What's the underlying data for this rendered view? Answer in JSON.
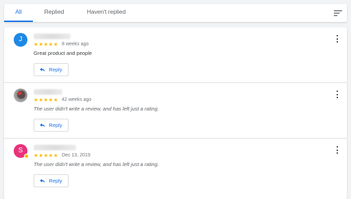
{
  "tabs": [
    {
      "label": "All",
      "active": true
    },
    {
      "label": "Replied",
      "active": false
    },
    {
      "label": "Haven't replied",
      "active": false
    }
  ],
  "colors": {
    "accent": "#1a73e8",
    "star": "#fbbc04"
  },
  "reviews": [
    {
      "avatar_letter": "J",
      "avatar_color": "#1e88e5",
      "stars": "★★★★★",
      "rating": 5,
      "time": "8 weeks ago",
      "text": "Great product and people",
      "reply_label": "Reply"
    },
    {
      "avatar_letter": "",
      "avatar_color": "#9e9e9e",
      "stars": "★★★★★",
      "rating": 5,
      "time": "42 weeks ago",
      "text": "The user didn't write a review, and has left just a rating.",
      "reply_label": "Reply"
    },
    {
      "avatar_letter": "S",
      "avatar_color": "#e8327c",
      "stars": "★★★★★",
      "rating": 5,
      "time": "Dec 13, 2019",
      "text": "The user didn't write a review, and has left just a rating.",
      "reply_label": "Reply"
    }
  ]
}
